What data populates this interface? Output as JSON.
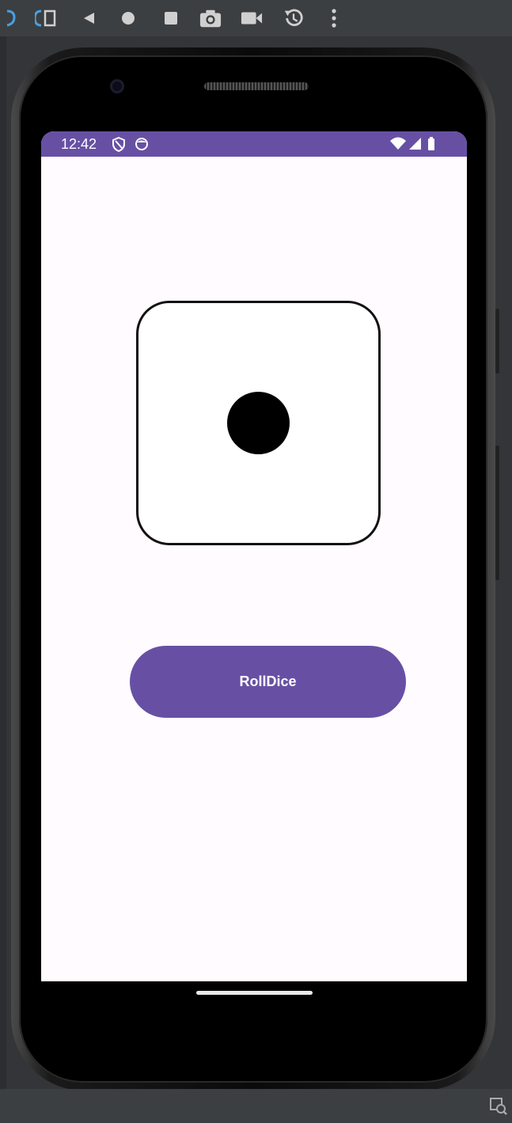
{
  "toolbar": {
    "icons": [
      "rotate-left-icon",
      "rotate-right-icon",
      "back-icon",
      "home-icon",
      "overview-icon",
      "screenshot-icon",
      "screen-record-icon",
      "snapshot-icon",
      "more-icon"
    ]
  },
  "status_bar": {
    "time": "12:42",
    "color": "#6750a4",
    "icons": [
      "shield-icon",
      "app-notification-icon",
      "wifi-icon",
      "signal-icon",
      "battery-icon"
    ]
  },
  "dice": {
    "face_value": 1
  },
  "main": {
    "roll_button_label": "RollDice",
    "accent_color": "#6750a4",
    "background_color": "#fffbfe"
  },
  "bottom_bar": {
    "icons": [
      "layout-inspector-icon"
    ]
  }
}
